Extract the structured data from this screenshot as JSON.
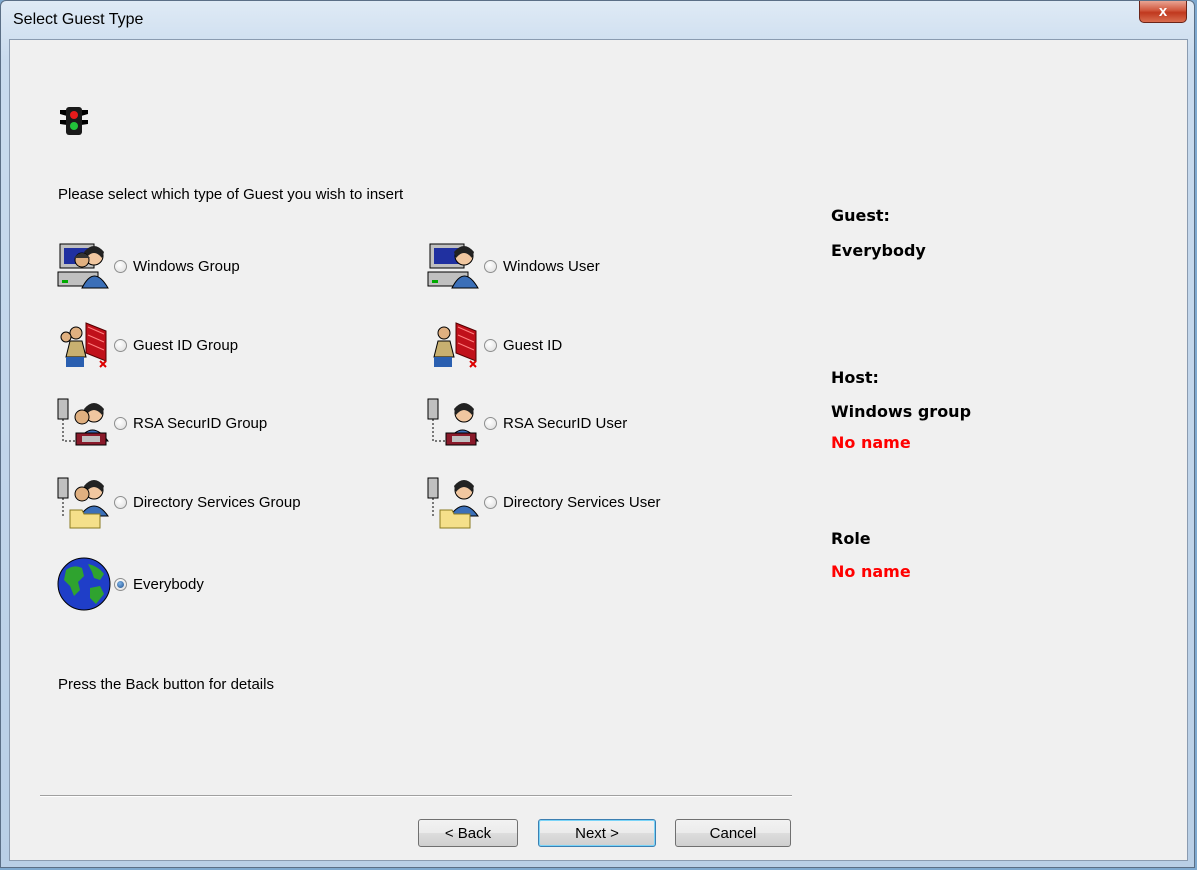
{
  "window": {
    "title": "Select Guest Type",
    "close_symbol": "x"
  },
  "instruction": "Please select which type of Guest you wish to insert",
  "options": [
    {
      "label": "Windows Group",
      "icon": "windows-group-icon",
      "checked": false
    },
    {
      "label": "Windows User",
      "icon": "windows-user-icon",
      "checked": false
    },
    {
      "label": "Guest ID Group",
      "icon": "guest-id-group-icon",
      "checked": false
    },
    {
      "label": "Guest ID",
      "icon": "guest-id-icon",
      "checked": false
    },
    {
      "label": "RSA SecurID Group",
      "icon": "rsa-securid-group-icon",
      "checked": false
    },
    {
      "label": "RSA SecurID User",
      "icon": "rsa-securid-user-icon",
      "checked": false
    },
    {
      "label": "Directory Services Group",
      "icon": "directory-services-group-icon",
      "checked": false
    },
    {
      "label": "Directory Services User",
      "icon": "directory-services-user-icon",
      "checked": false
    },
    {
      "label": "Everybody",
      "icon": "globe-icon",
      "checked": true
    }
  ],
  "footer_note": "Press the Back button for details",
  "summary": {
    "guest_label": "Guest:",
    "guest_value": "Everybody",
    "host_label": "Host:",
    "host_value": "Windows group",
    "host_name": "No name",
    "role_label": "Role",
    "role_name": "No name"
  },
  "buttons": {
    "back": "< Back",
    "next": "Next >",
    "cancel": "Cancel"
  },
  "colors": {
    "warning_text": "#ff0000"
  }
}
